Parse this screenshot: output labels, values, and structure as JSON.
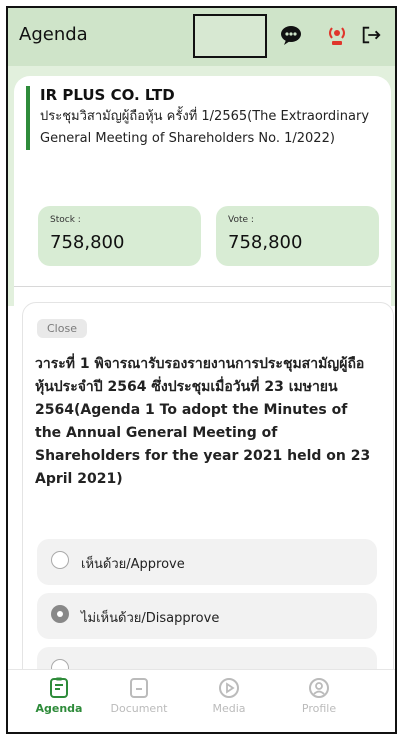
{
  "header": {
    "title": "Agenda"
  },
  "company": {
    "name": "IR PLUS CO. LTD",
    "meeting": "ประชุมวิสามัญผู้ถือหุ้น ครั้งที่ 1/2565(The Extraordinary General Meeting of Shareholders No. 1/2022)"
  },
  "stats": {
    "stock_label": "Stock :",
    "stock_value": "758,800",
    "vote_label": "Vote :",
    "vote_value": "758,800"
  },
  "agenda": {
    "badge": "Close",
    "text": "วาระที่ 1 พิจารณารับรองรายงานการประชุมสามัญผู้ถือหุ้นประจำปี 2564 ซึ่งประชุมเมื่อวันที่ 23 เมษายน 2564(Agenda 1 To adopt the Minutes of the Annual General Meeting of Shareholders for the year 2021 held on 23 April 2021)",
    "options": [
      {
        "label": "เห็นด้วย/Approve",
        "selected": false
      },
      {
        "label": "ไม่เห็นด้วย/Disapprove",
        "selected": true
      }
    ]
  },
  "tabs": [
    {
      "label": "Agenda",
      "icon": "agenda-icon",
      "active": true
    },
    {
      "label": "Document",
      "icon": "document-icon",
      "active": false
    },
    {
      "label": "Media",
      "icon": "media-icon",
      "active": false
    },
    {
      "label": "Profile",
      "icon": "profile-icon",
      "active": false
    }
  ],
  "colors": {
    "accent": "#2e8b3a",
    "header_bg": "#cfe4c9",
    "live_red": "#e0352b"
  }
}
